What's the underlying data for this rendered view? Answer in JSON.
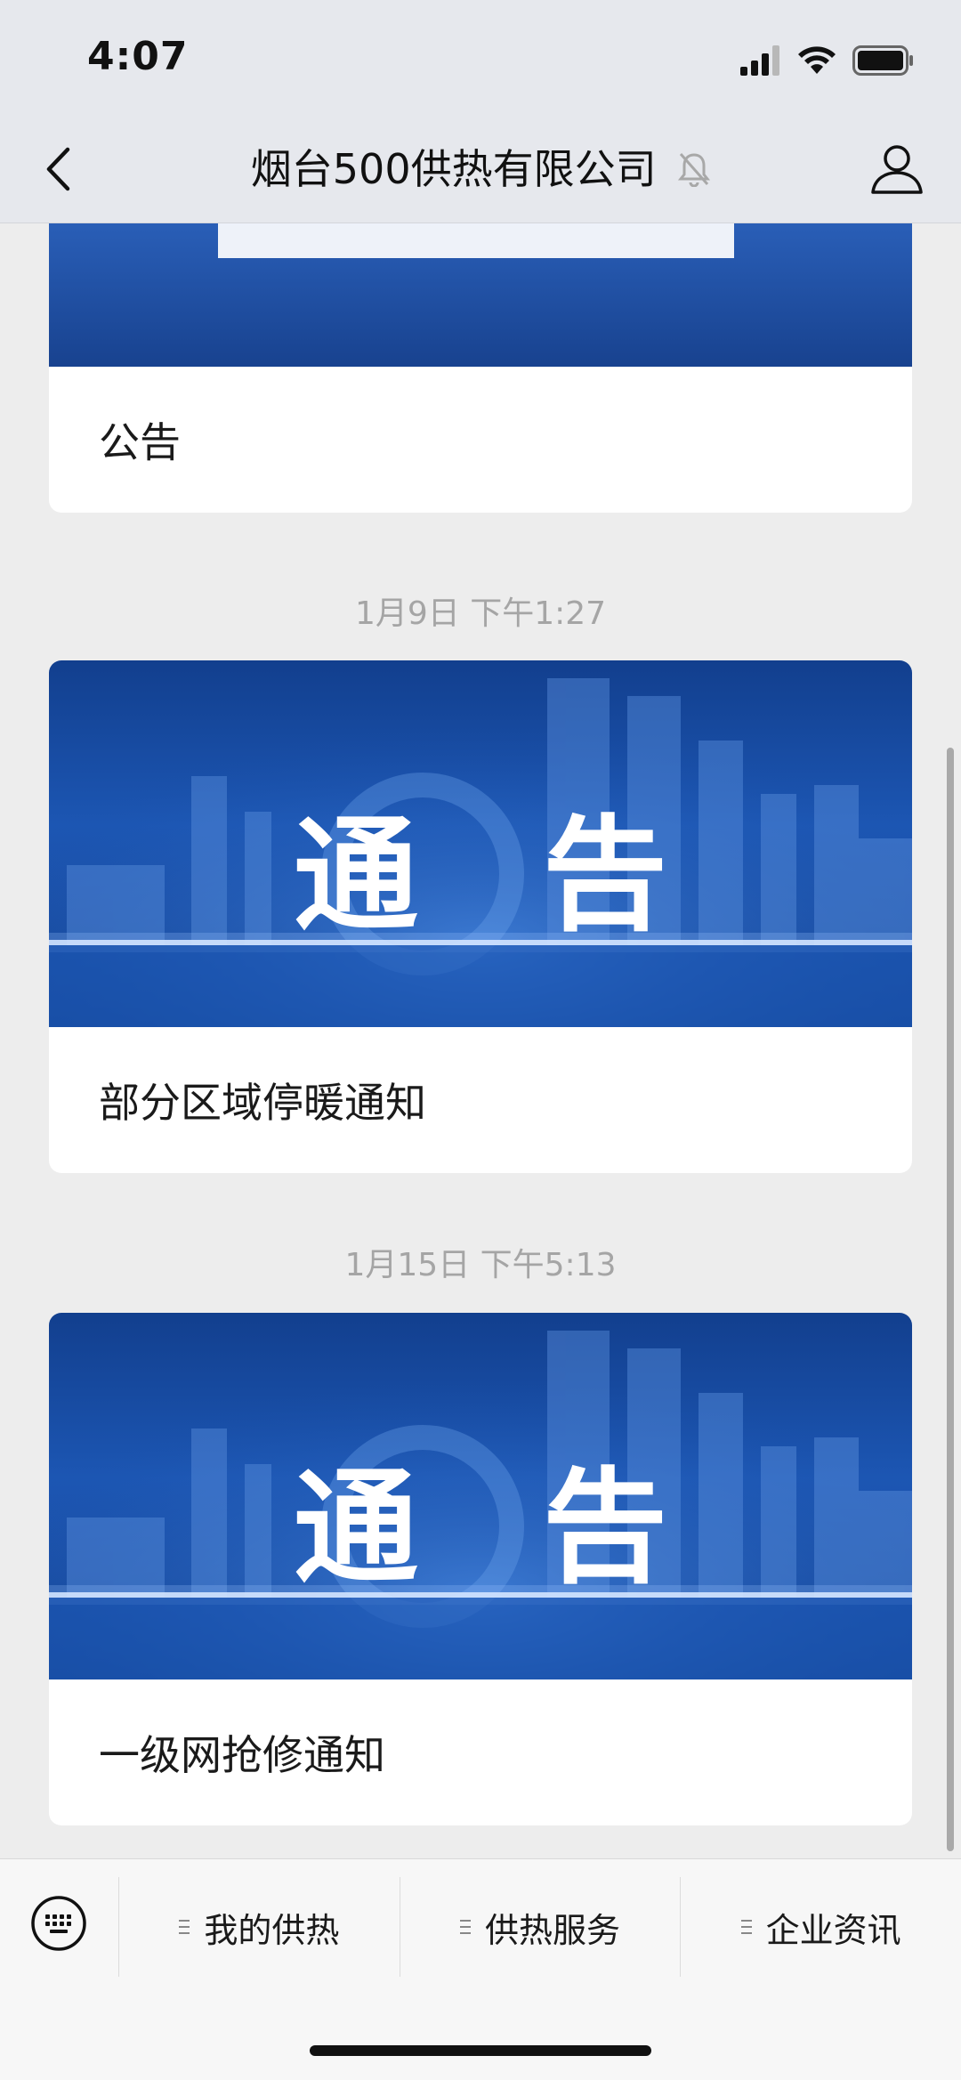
{
  "status_bar": {
    "time": "4:07",
    "signal_icon": "signal-bars-icon",
    "wifi_icon": "wifi-icon",
    "battery_icon": "battery-icon"
  },
  "nav": {
    "back_icon": "chevron-left-icon",
    "title": "烟台500供热有限公司",
    "mute_icon": "bell-muted-icon",
    "profile_icon": "person-icon"
  },
  "feed": [
    {
      "timestamp": "",
      "title": "公告",
      "banner_text": ""
    },
    {
      "timestamp": "1月9日 下午1:27",
      "title": "部分区域停暖通知",
      "banner_text": "通　告"
    },
    {
      "timestamp": "1月15日 下午5:13",
      "title": "一级网抢修通知",
      "banner_text": "通　告"
    }
  ],
  "bottom_menu": {
    "keyboard_icon": "keyboard-icon",
    "items": [
      {
        "label": "我的供热"
      },
      {
        "label": "供热服务"
      },
      {
        "label": "企业资讯"
      }
    ]
  },
  "colors": {
    "banner_blue": "#1c56b3",
    "background": "#ededed",
    "timestamp_gray": "#a5a5a5"
  }
}
